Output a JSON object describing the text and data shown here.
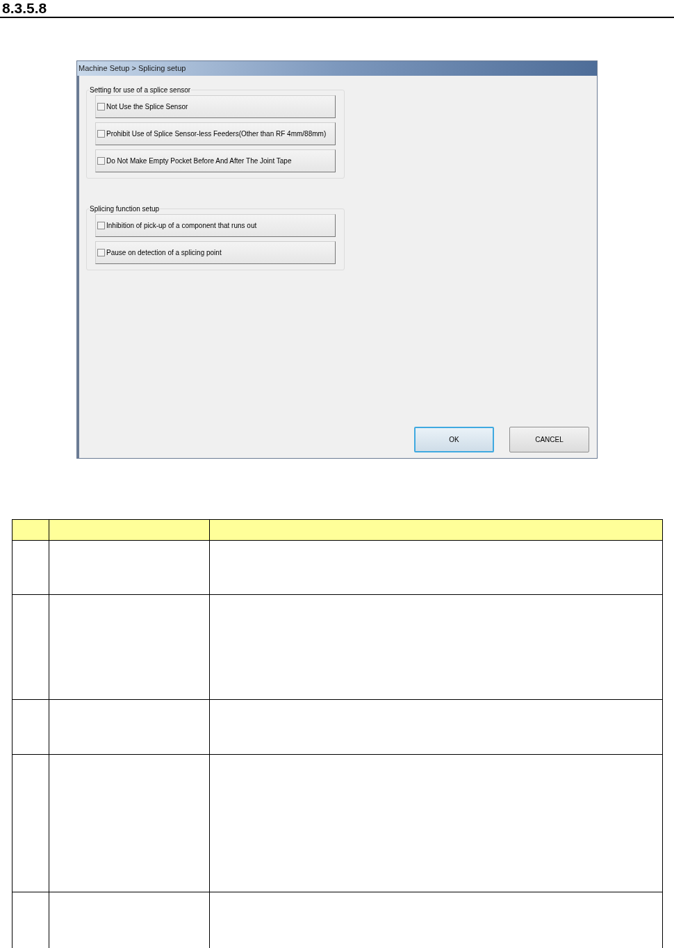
{
  "heading": "8.3.5.8",
  "window": {
    "title": "Machine Setup > Splicing setup"
  },
  "groups": [
    {
      "title": "Setting for use of a splice sensor",
      "options": [
        {
          "label": "Not Use the Splice Sensor",
          "checked": false
        },
        {
          "label": "Prohibit Use of Splice Sensor-less Feeders(Other than RF 4mm/88mm)",
          "checked": false
        },
        {
          "label": "Do Not Make Empty Pocket Before And After The Joint Tape",
          "checked": false
        }
      ]
    },
    {
      "title": "Splicing function setup",
      "options": [
        {
          "label": "Inhibition of pick-up of a component that runs out",
          "checked": false
        },
        {
          "label": "Pause on detection of a splicing point",
          "checked": false
        }
      ]
    }
  ],
  "buttons": [
    {
      "label": "OK",
      "focused": true
    },
    {
      "label": "CANCEL",
      "focused": false
    }
  ]
}
